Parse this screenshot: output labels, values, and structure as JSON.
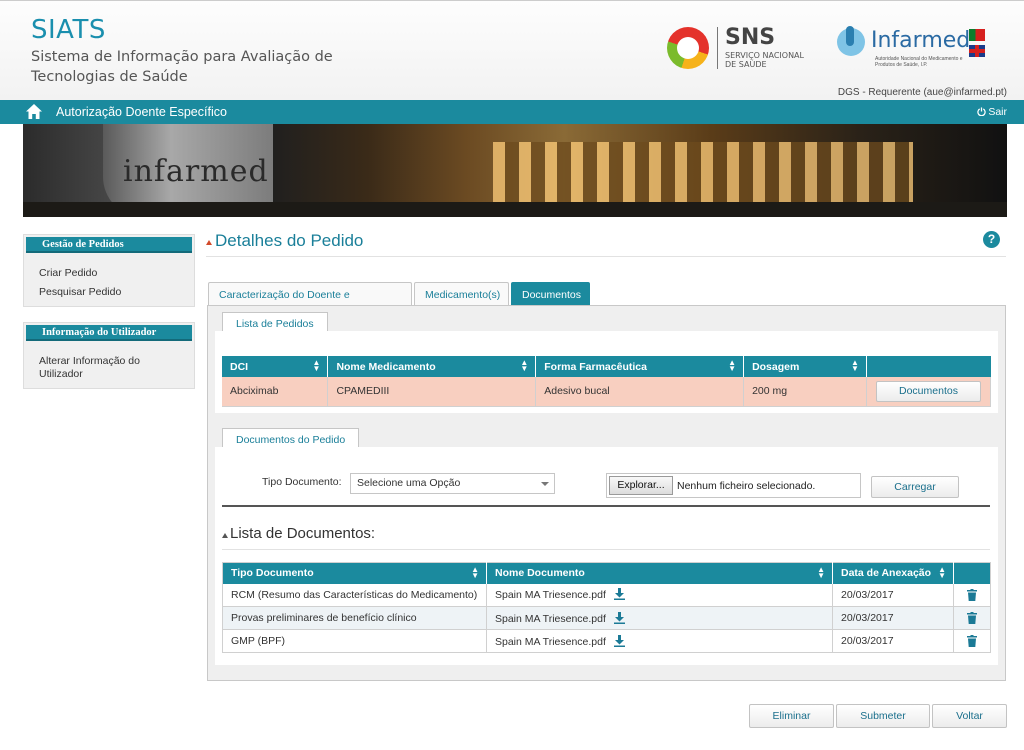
{
  "header": {
    "app_title": "SIATS",
    "app_subtitle": "Sistema de Informação para Avaliação de Tecnologias de Saúde",
    "sns_logo": {
      "name": "SNS",
      "sub": "SERVIÇO NACIONAL DE SAÚDE"
    },
    "infarmed_logo": {
      "name": "Infarmed",
      "sub": "Autoridade Nacional do Medicamento e Produtos de Saúde, I.P."
    },
    "user_info": "DGS - Requerente (aue@infarmed.pt)"
  },
  "navbar": {
    "title": "Autorização Doente Específico",
    "logout_label": "Sair",
    "home_icon": "home-icon",
    "logout_icon": "power-icon"
  },
  "banner": {
    "logo_text": "infarmed"
  },
  "sidebar": {
    "sections": [
      {
        "title": "Gestão de Pedidos",
        "items": [
          "Criar Pedido",
          "Pesquisar Pedido"
        ]
      },
      {
        "title": "Informação do Utilizador",
        "items": [
          "Alterar Informação do Utilizador"
        ]
      }
    ]
  },
  "main": {
    "page_title": "Detalhes do Pedido",
    "help_label": "?",
    "tabs": [
      "Caracterização do Doente e Tratamento",
      "Medicamento(s)",
      "Documentos"
    ],
    "active_tab": "Documentos",
    "pedidos": {
      "subtab_label": "Lista de Pedidos",
      "columns": [
        "DCI",
        "Nome Medicamento",
        "Forma Farmacêutica",
        "Dosagem",
        ""
      ],
      "rows": [
        {
          "dci": "Abciximab",
          "nome": "CPAMEDIII",
          "forma": "Adesivo bucal",
          "dosagem": "200 mg",
          "action": "Documentos"
        }
      ]
    },
    "documentos_pedido": {
      "subtab_label": "Documentos do Pedido",
      "tipo_label": "Tipo Documento:",
      "tipo_value": "Selecione uma Opção",
      "browse_label": "Explorar...",
      "file_status": "Nenhum ficheiro selecionado.",
      "upload_label": "Carregar"
    },
    "lista_documentos": {
      "title": "Lista de Documentos:",
      "columns": [
        "Tipo Documento",
        "Nome Documento",
        "Data de Anexação",
        ""
      ],
      "rows": [
        {
          "tipo": "RCM (Resumo das Características do Medicamento)",
          "nome": "Spain MA Triesence.pdf",
          "data": "20/03/2017"
        },
        {
          "tipo": "Provas preliminares de benefício clínico",
          "nome": "Spain MA Triesence.pdf",
          "data": "20/03/2017"
        },
        {
          "tipo": "GMP (BPF)",
          "nome": "Spain MA Triesence.pdf",
          "data": "20/03/2017"
        }
      ]
    },
    "actions": {
      "delete": "Eliminar",
      "submit": "Submeter",
      "back": "Voltar"
    }
  },
  "colors": {
    "accent": "#1b8a9e",
    "title": "#1a7f99",
    "highlight_row": "#f8cfc0"
  }
}
